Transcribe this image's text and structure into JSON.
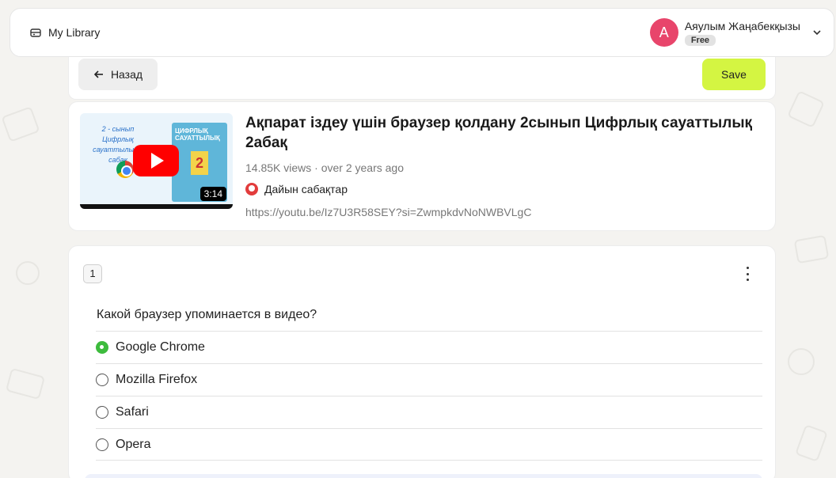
{
  "header": {
    "library_label": "My Library",
    "library_icon": "library-icon",
    "user": {
      "avatar_letter": "A",
      "avatar_color": "#e8456b",
      "name": "Аяулым Жаңабекқызы",
      "plan": "Free"
    }
  },
  "actions": {
    "back_label": "Назад",
    "save_label": "Save",
    "save_color": "#d4f542"
  },
  "video": {
    "title": "Ақпарат іздеу үшін браузер қолдану 2сынып Цифрлық сауаттылық 2абақ",
    "meta": "14.85K views · over 2 years ago",
    "channel": "Дайын сабақтар",
    "url": "https://youtu.be/Iz7U3R58SEY?si=ZwmpkdvNoNWBVLgC",
    "duration": "3:14",
    "thumb_left_text": "2 - сынып Цифрлық сауаттылық 2 сабақ",
    "thumb_book_title": "ЦИФРЛЫҚ САУАТТЫЛЫҚ",
    "thumb_book_number": "2"
  },
  "question": {
    "number": "1",
    "text": "Какой браузер упоминается в видео?",
    "options": [
      {
        "label": "Google Chrome",
        "checked": true
      },
      {
        "label": "Mozilla Firefox",
        "checked": false
      },
      {
        "label": "Safari",
        "checked": false
      },
      {
        "label": "Opera",
        "checked": false
      }
    ],
    "correct_color": "#3dbb3d"
  }
}
